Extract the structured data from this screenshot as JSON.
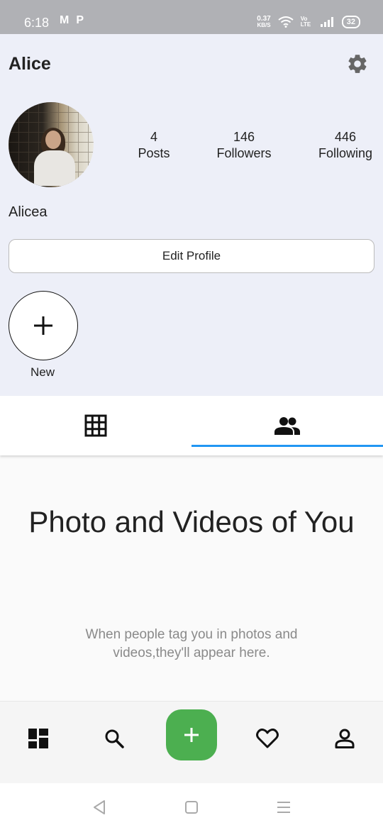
{
  "status_bar": {
    "time": "6:18",
    "net_speed": "0.37",
    "net_unit": "KB/S",
    "volte": "Vo LTE",
    "battery": "32"
  },
  "profile": {
    "username": "Alice",
    "display_name": "Alicea",
    "stats": [
      {
        "value": "4",
        "label": "Posts"
      },
      {
        "value": "146",
        "label": "Followers"
      },
      {
        "value": "446",
        "label": "Following"
      }
    ],
    "edit_button": "Edit Profile",
    "new_story_label": "New"
  },
  "tabs": {
    "items": [
      {
        "icon": "grid-icon"
      },
      {
        "icon": "people-icon"
      }
    ],
    "active_index": 1,
    "accent": "#2196f3"
  },
  "empty_state": {
    "title": "Photo and Videos of You",
    "subtitle": "When people tag you in photos and videos,they'll appear here."
  },
  "bottom_nav": {
    "items": [
      "dashboard-icon",
      "search-icon",
      "add-icon",
      "heart-icon",
      "person-icon"
    ],
    "fab_color": "#4caf50"
  }
}
